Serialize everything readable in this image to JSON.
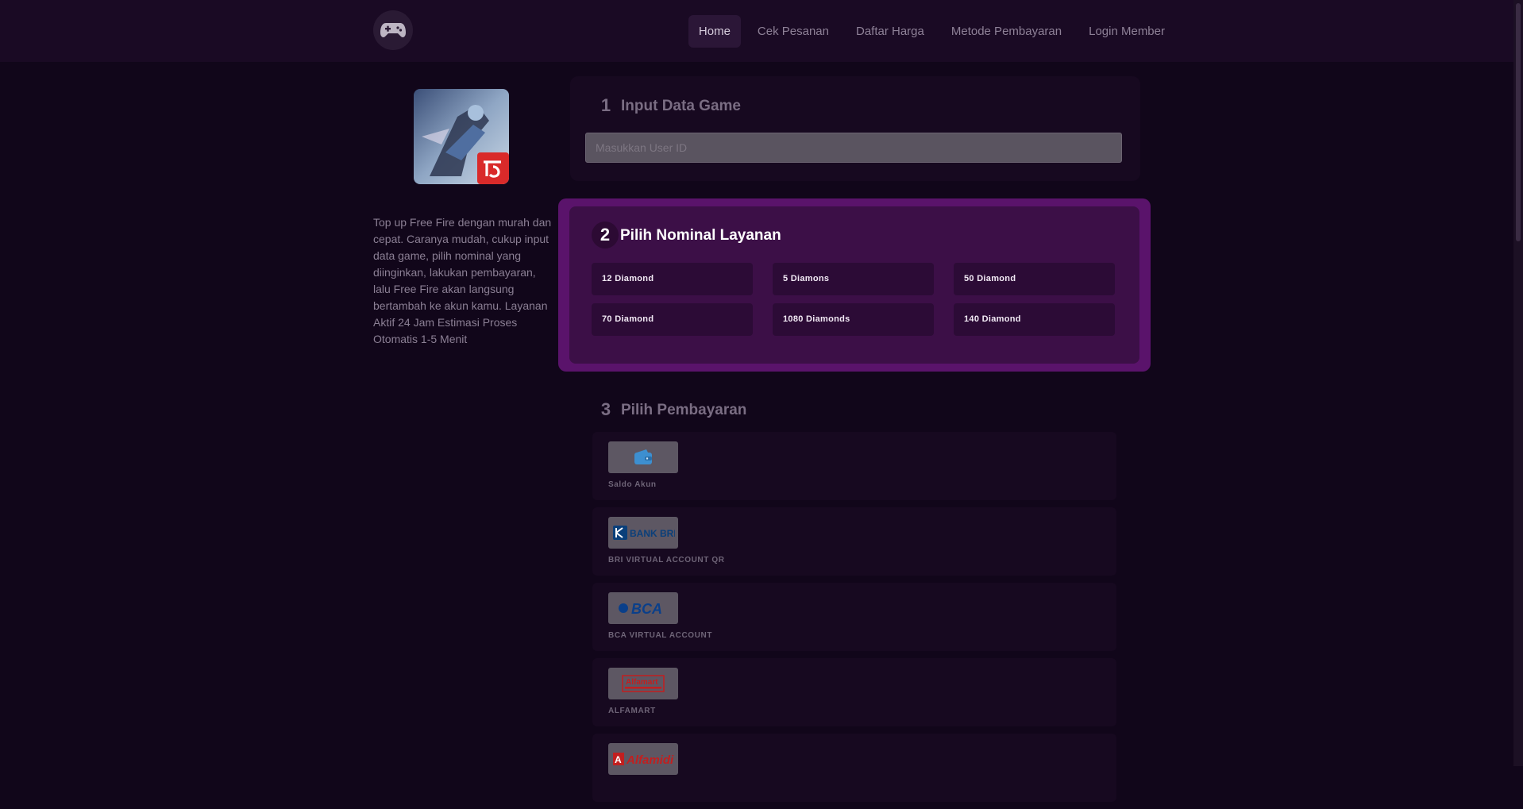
{
  "header": {
    "logo_icon": "gamepad-icon",
    "nav": [
      {
        "label": "Home",
        "active": true
      },
      {
        "label": "Cek Pesanan",
        "active": false
      },
      {
        "label": "Daftar Harga",
        "active": false
      },
      {
        "label": "Metode Pembayaran",
        "active": false
      },
      {
        "label": "Login Member",
        "active": false
      }
    ]
  },
  "game": {
    "image_icon": "free-fire-game-cover",
    "description": "Top up Free Fire dengan murah dan cepat. Caranya mudah, cukup input data game, pilih nominal yang diinginkan, lakukan pembayaran, lalu Free Fire akan langsung bertambah ke akun kamu. Layanan Aktif 24 Jam Estimasi Proses Otomatis 1-5 Menit"
  },
  "step1": {
    "number": "1",
    "title": "Input Data Game",
    "user_id_placeholder": "Masukkan User ID"
  },
  "step2": {
    "number": "2",
    "title": "Pilih Nominal Layanan",
    "items": [
      "12 Diamond",
      "5 Diamons",
      "50 Diamond",
      "70 Diamond",
      "1080 Diamonds",
      "140 Diamond"
    ]
  },
  "step3": {
    "number": "3",
    "title": "Pilih Pembayaran",
    "methods": [
      {
        "label": "Saldo Akun",
        "logo": "wallet-icon"
      },
      {
        "label": "BRI VIRTUAL ACCOUNT QR",
        "logo": "bank-bri-logo",
        "logo_text": "BANK BRI"
      },
      {
        "label": "BCA VIRTUAL ACCOUNT",
        "logo": "bca-logo",
        "logo_text": "BCA"
      },
      {
        "label": "ALFAMART",
        "logo": "alfamart-logo",
        "logo_text": "Alfamart"
      },
      {
        "label": "",
        "logo": "alfamidi-logo",
        "logo_text": "Alfamidi"
      }
    ]
  },
  "colors": {
    "background": "#11061a",
    "header": "#1a0a24",
    "highlight_border": "#5a136b",
    "highlight_panel": "#3c0f47",
    "nominal_card": "#2c0b36"
  }
}
